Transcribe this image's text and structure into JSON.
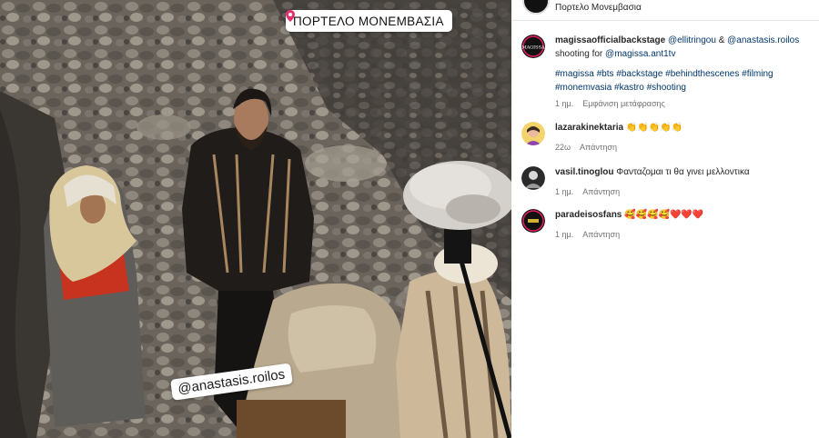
{
  "post": {
    "location_sticker": "ΠΟΡΤΕΛΟ ΜΟΝΕΜΒΑΣΙΑ",
    "tag_sticker": "@anastasis.roilos"
  },
  "sidebar": {
    "location": "Πορτελο Μονεμβασια",
    "caption": {
      "username": "magissaofficialbackstage",
      "line1_mentions": [
        "@ellitringou",
        " & ",
        "@anastasis.roilos"
      ],
      "line2_prefix": "shooting for ",
      "line2_mention": "@magissa.ant1tv",
      "hashtags_line1": "#magissa #bts #backstage #behindthescenes #filming",
      "hashtags_line2": "#monemvasia #kastro #shooting",
      "time": "1 ημ.",
      "translate": "Εμφάνιση μετάφρασης"
    },
    "comments": [
      {
        "username": "lazarakinektaria",
        "text": "👏👏👏👏👏",
        "time": "22ω",
        "reply": "Απάντηση"
      },
      {
        "username": "vasil.tinoglou",
        "text": "Φανταζομαι τι θα γινει μελλοντικα",
        "time": "1 ημ.",
        "reply": "Απάντηση"
      },
      {
        "username": "paradeisosfans",
        "text": "🥰🥰🥰🥰❤️❤️❤️",
        "time": "1 ημ.",
        "reply": "Απάντηση"
      }
    ]
  },
  "colors": {
    "link": "#00376b",
    "meta": "#737373",
    "text": "#262626"
  }
}
